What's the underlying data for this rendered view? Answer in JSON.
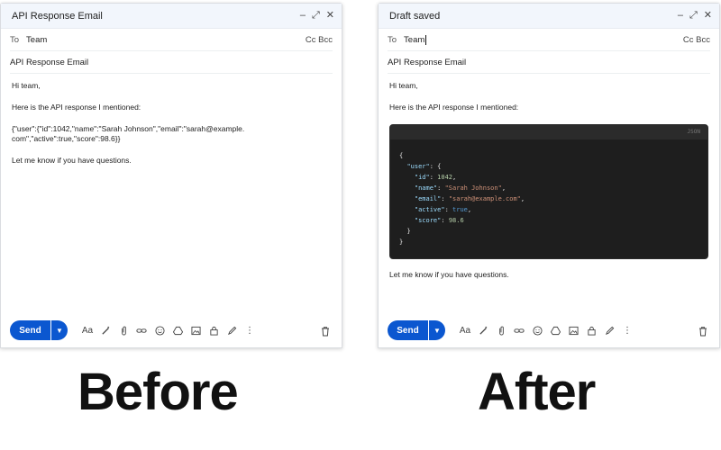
{
  "before": {
    "window_title": "API Response Email",
    "to_label": "To",
    "recipient": "Team",
    "cc_bcc": "Cc Bcc",
    "subject": "API Response Email",
    "greeting": "Hi team,",
    "intro": "Here is the API response I mentioned:",
    "json_text": "{\"user\":{\"id\":1042,\"name\":\"Sarah Johnson\",\"email\":\"sarah@example.com\",\"active\":true,\"score\":98.6}}",
    "closing": "Let me know if you have questions.",
    "send_label": "Send"
  },
  "after": {
    "window_title": "Draft saved",
    "to_label": "To",
    "recipient": "Team",
    "cc_bcc": "Cc Bcc",
    "subject": "API Response Email",
    "greeting": "Hi team,",
    "intro": "Here is the API response I mentioned:",
    "code_lang": "JSON",
    "code": {
      "open": "{",
      "user_key": "\"user\"",
      "id_key": "\"id\"",
      "id_val": "1042",
      "name_key": "\"name\"",
      "name_val": "\"Sarah Johnson\"",
      "email_key": "\"email\"",
      "email_val": "\"sarah@example.com\"",
      "active_key": "\"active\"",
      "active_val": "true",
      "score_key": "\"score\"",
      "score_val": "98.6",
      "close_inner": "}",
      "close_outer": "}"
    },
    "closing": "Let me know if you have questions.",
    "send_label": "Send"
  },
  "captions": {
    "before": "Before",
    "after": "After"
  },
  "toolbar_text": {
    "format": "Aa"
  },
  "colors": {
    "send": "#0b57d0",
    "code_bg": "#1e1e1e",
    "titlebar": "#f2f6fc"
  }
}
